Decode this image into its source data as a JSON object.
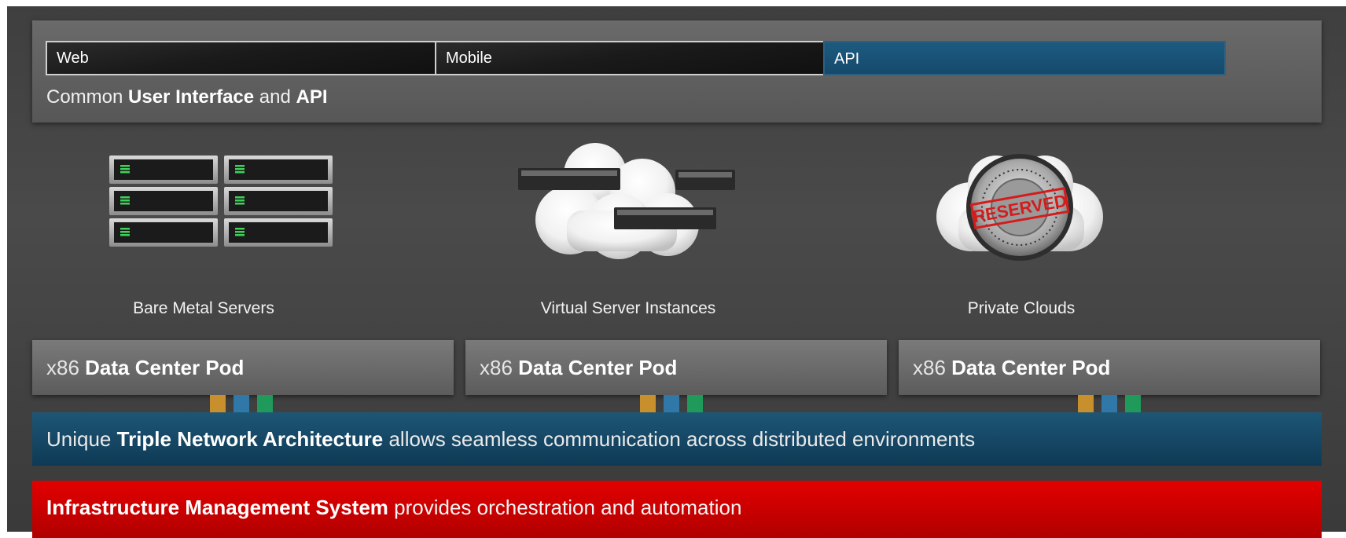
{
  "ui_layer": {
    "boxes": [
      {
        "label": "Web"
      },
      {
        "label": "Mobile"
      },
      {
        "label": "API"
      }
    ],
    "caption": {
      "prefix": "Common",
      "bold1": "User Interface",
      "mid": "and",
      "bold2": "API"
    }
  },
  "services": [
    {
      "label": "Bare Metal Servers",
      "icon": "server-rack-icon"
    },
    {
      "label": "Virtual Server Instances",
      "icon": "cloud-servers-icon"
    },
    {
      "label": "Private Clouds",
      "icon": "cloud-vault-icon",
      "stamp": "RESERVED"
    }
  ],
  "pods": [
    {
      "thin": "x86",
      "bold": "Data Center Pod"
    },
    {
      "thin": "x86",
      "bold": "Data Center Pod"
    },
    {
      "thin": "x86",
      "bold": "Data Center Pod"
    }
  ],
  "network": {
    "prefix": "Unique",
    "bold": "Triple Network Architecture",
    "suffix": "allows seamless communication across distributed environments"
  },
  "ims": {
    "bold": "Infrastructure Management System",
    "suffix": "provides orchestration and automation"
  },
  "colors": {
    "api": "#1d5a80",
    "network": "#174c6b",
    "ims": "#d40000",
    "cable_orange": "#c8902c",
    "cable_blue": "#2f78a8",
    "cable_green": "#1f9a5a",
    "led_green": "#3fd05a"
  }
}
